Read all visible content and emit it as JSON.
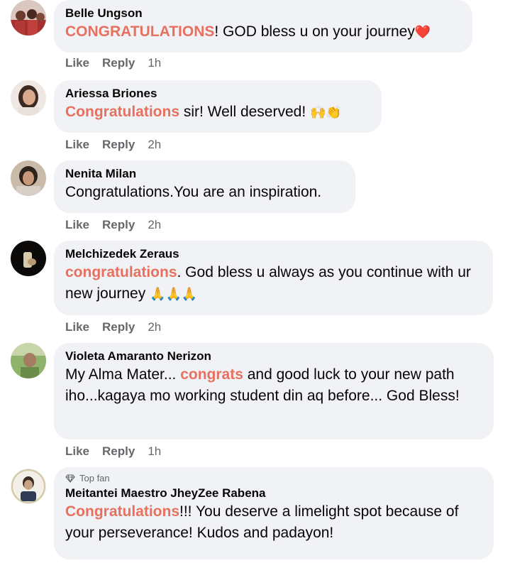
{
  "comments": [
    {
      "name": "Belle Ungson",
      "pre": "",
      "highlight": "CONGRATULATIONS",
      "post": "! GOD bless u on your journey",
      "emoji": "❤️",
      "like": "Like",
      "reply": "Reply",
      "time": "1h"
    },
    {
      "name": "Ariessa Briones",
      "pre": "",
      "highlight": "Congratulations",
      "post": " sir! Well deserved! ",
      "emoji": "🙌👏",
      "like": "Like",
      "reply": "Reply",
      "time": "2h"
    },
    {
      "name": "Nenita Milan",
      "pre": "",
      "highlight": "",
      "post": "Congratulations.You are an inspiration.",
      "emoji": "",
      "like": "Like",
      "reply": "Reply",
      "time": "2h"
    },
    {
      "name": "Melchizedek Zeraus",
      "pre": "",
      "highlight": "congratulations",
      "post": ". God bless u always as you continue with ur new journey ",
      "emoji": "🙏🙏🙏",
      "like": "Like",
      "reply": "Reply",
      "time": "2h"
    },
    {
      "name": "Violeta Amaranto Nerizon",
      "pre": "My Alma Mater... ",
      "highlight": "congrats",
      "post": " and good luck to your new path iho...kagaya mo working student din aq before... God Bless!",
      "emoji": "",
      "like": "Like",
      "reply": "Reply",
      "time": "1h"
    },
    {
      "badge": "Top fan",
      "name": "Meitantei Maestro JheyZee Rabena",
      "pre": "",
      "highlight": "Congratulations",
      "post": "!!! You deserve a limelight spot because of your perseverance! Kudos and padayon!",
      "emoji": ""
    }
  ],
  "colors": {
    "highlight": "#e8705e",
    "bubble": "#f0f2f5",
    "meta": "#65676b"
  }
}
